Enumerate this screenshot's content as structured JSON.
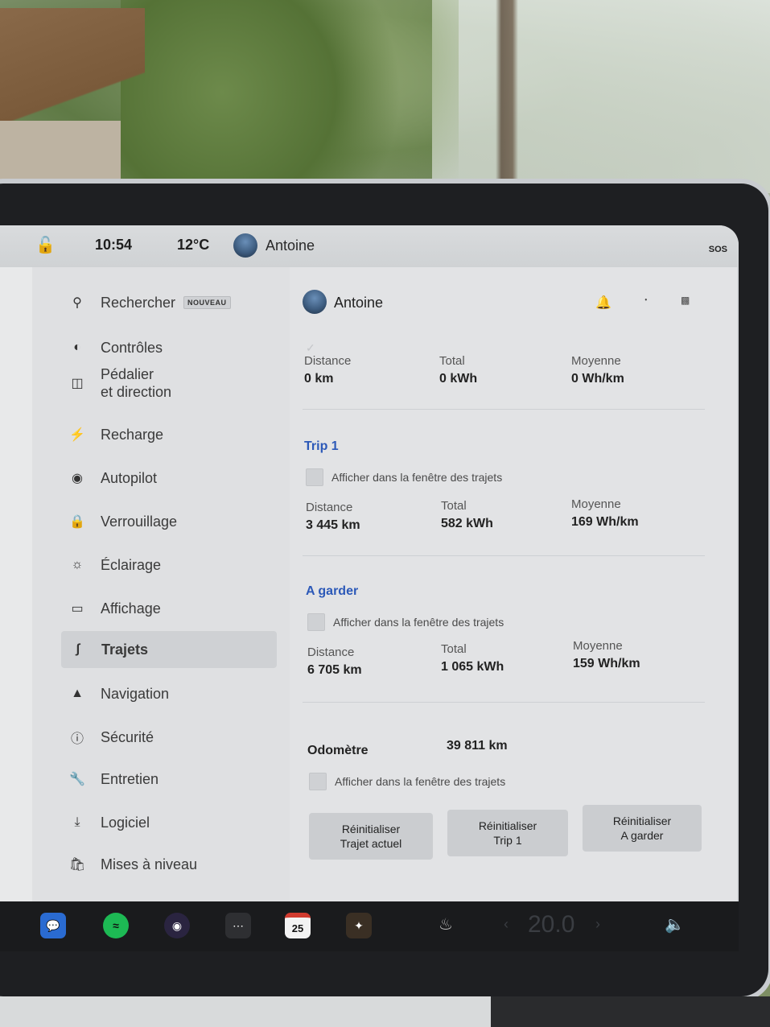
{
  "statusbar": {
    "time": "10:54",
    "temperature": "12°C",
    "user": "Antoine",
    "sos": "SOS"
  },
  "sidebar": {
    "items": [
      {
        "label": "Rechercher",
        "badge": "NOUVEAU",
        "icon": "search-icon"
      },
      {
        "label": "Contrôles",
        "icon": "toggle-icon"
      },
      {
        "label": "Pédalier",
        "label2": "et direction",
        "icon": "car-icon"
      },
      {
        "label": "Recharge",
        "icon": "bolt-icon"
      },
      {
        "label": "Autopilot",
        "icon": "steering-wheel-icon"
      },
      {
        "label": "Verrouillage",
        "icon": "lock-icon"
      },
      {
        "label": "Éclairage",
        "icon": "sun-icon"
      },
      {
        "label": "Affichage",
        "icon": "display-icon"
      },
      {
        "label": "Trajets",
        "icon": "trips-icon",
        "active": true
      },
      {
        "label": "Navigation",
        "icon": "navigation-icon"
      },
      {
        "label": "Sécurité",
        "icon": "safety-icon"
      },
      {
        "label": "Entretien",
        "icon": "wrench-icon"
      },
      {
        "label": "Logiciel",
        "icon": "download-icon"
      },
      {
        "label": "Mises à niveau",
        "icon": "bag-icon"
      }
    ]
  },
  "profile": {
    "name": "Antoine"
  },
  "current_trip": {
    "distance_label": "Distance",
    "distance_value": "0 km",
    "total_label": "Total",
    "total_value": "0 kWh",
    "avg_label": "Moyenne",
    "avg_value": "0 Wh/km"
  },
  "trip1": {
    "title": "Trip 1",
    "checkbox_label": "Afficher dans la fenêtre des trajets",
    "distance_label": "Distance",
    "distance_value": "3 445 km",
    "total_label": "Total",
    "total_value": "582 kWh",
    "avg_label": "Moyenne",
    "avg_value": "169 Wh/km"
  },
  "keep": {
    "title": "A garder",
    "checkbox_label": "Afficher dans la fenêtre des trajets",
    "distance_label": "Distance",
    "distance_value": "6 705 km",
    "total_label": "Total",
    "total_value": "1 065 kWh",
    "avg_label": "Moyenne",
    "avg_value": "159 Wh/km"
  },
  "odometer": {
    "label": "Odomètre",
    "value": "39 811 km",
    "checkbox_label": "Afficher dans la fenêtre des trajets"
  },
  "buttons": {
    "reset_current_1": "Réinitialiser",
    "reset_current_2": "Trajet actuel",
    "reset_trip1_1": "Réinitialiser",
    "reset_trip1_2": "Trip 1",
    "reset_keep_1": "Réinitialiser",
    "reset_keep_2": "A garder"
  },
  "dock": {
    "calendar_day": "25",
    "cabin_temp": "20.0"
  },
  "colors": {
    "section_title": "#2c59b8",
    "screen_bg": "#e2e3e5",
    "dock_bg": "#1a1b1d"
  }
}
